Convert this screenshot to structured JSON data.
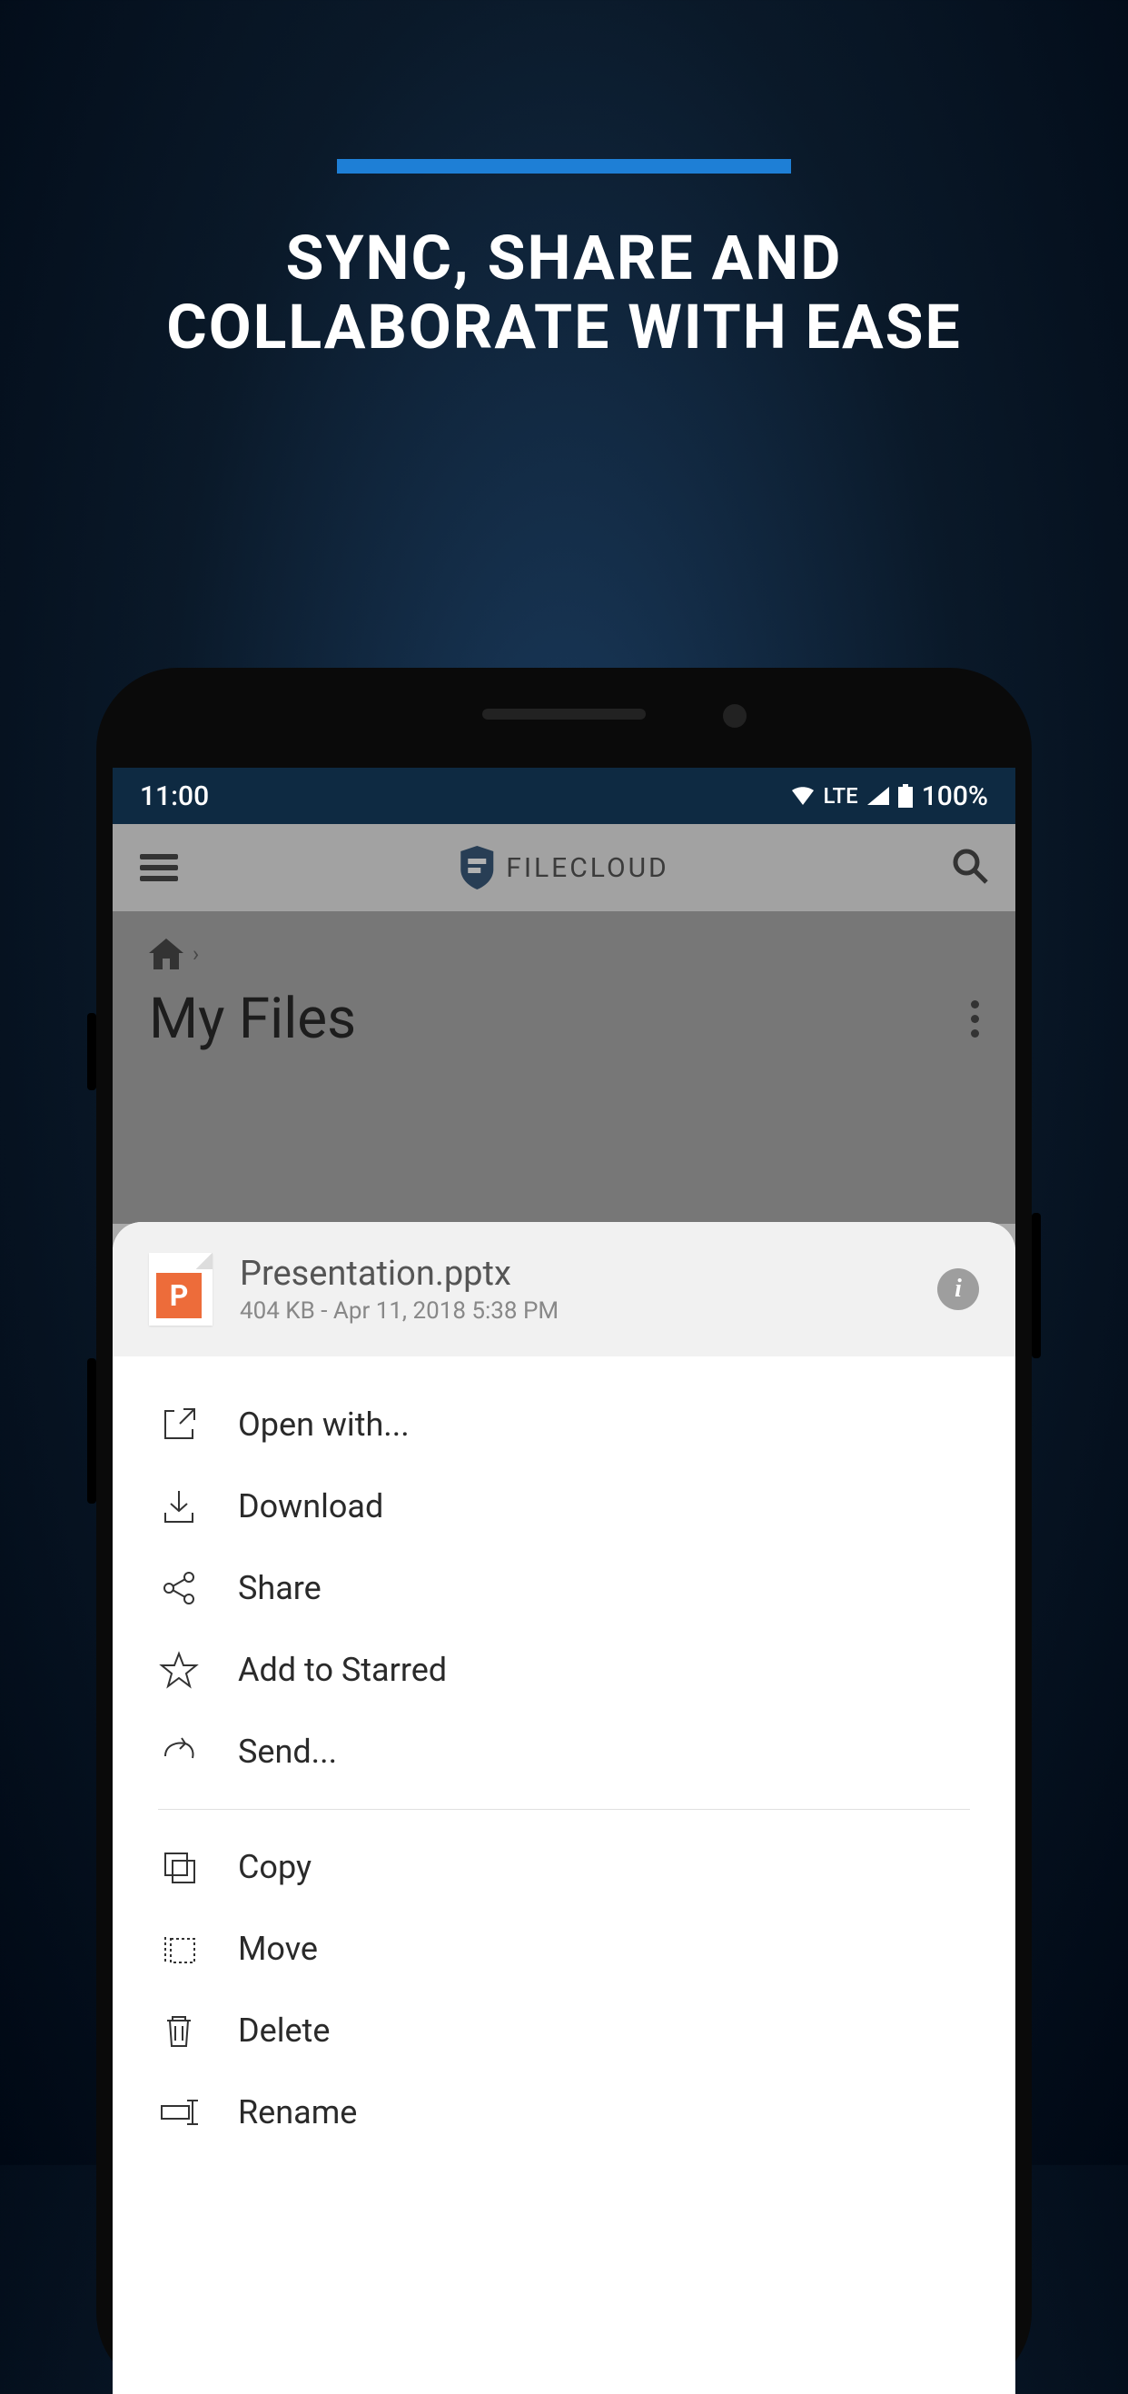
{
  "promo": {
    "title_line1": "SYNC, SHARE AND",
    "title_line2": "COLLABORATE WITH EASE"
  },
  "status_bar": {
    "time": "11:00",
    "network": "LTE",
    "battery": "100%"
  },
  "app": {
    "brand": "FILECLOUD"
  },
  "breadcrumb": {
    "page_title": "My Files"
  },
  "sheet": {
    "file": {
      "icon_letter": "P",
      "name": "Presentation.pptx",
      "meta": "404 KB - Apr 11, 2018 5:38 PM"
    },
    "actions_group1": [
      {
        "key": "open_with",
        "label": "Open with...",
        "icon": "open-external-icon"
      },
      {
        "key": "download",
        "label": "Download",
        "icon": "download-icon"
      },
      {
        "key": "share",
        "label": "Share",
        "icon": "share-icon"
      },
      {
        "key": "star",
        "label": "Add to Starred",
        "icon": "star-icon"
      },
      {
        "key": "send",
        "label": "Send...",
        "icon": "send-icon"
      }
    ],
    "actions_group2": [
      {
        "key": "copy",
        "label": "Copy",
        "icon": "copy-icon"
      },
      {
        "key": "move",
        "label": "Move",
        "icon": "move-icon"
      },
      {
        "key": "delete",
        "label": "Delete",
        "icon": "trash-icon"
      },
      {
        "key": "rename",
        "label": "Rename",
        "icon": "rename-icon"
      }
    ]
  }
}
